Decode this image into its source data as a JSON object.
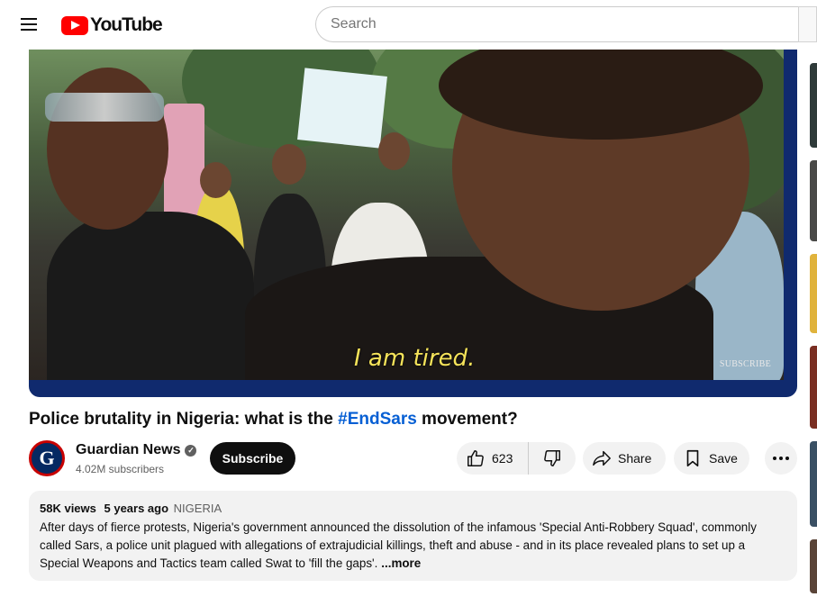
{
  "header": {
    "logo_text": "YouTube",
    "search_placeholder": "Search"
  },
  "player": {
    "caption": "I am tired.",
    "watermark": "SUBSCRIBE"
  },
  "video": {
    "title_prefix": "Police brutality in Nigeria: what is the ",
    "title_hashtag": "#EndSars",
    "title_suffix": " movement?"
  },
  "channel": {
    "avatar_letter": "G",
    "name": "Guardian News",
    "verified_mark": "✓",
    "subscribers": "4.02M subscribers",
    "subscribe_label": "Subscribe"
  },
  "actions": {
    "likes": "623",
    "share_label": "Share",
    "save_label": "Save"
  },
  "description": {
    "views": "58K views",
    "age": "5 years ago",
    "tag": "NIGERIA",
    "text": "After days of fierce protests, Nigeria's government announced the dissolution of the infamous 'Special Anti-Robbery Squad', commonly called Sars, a police unit plagued with allegations of extrajudicial killings, theft and abuse - and in its place revealed plans to set up a Special Weapons and Tactics team called Swat to 'fill the gaps'.",
    "more_label": "...more"
  },
  "colors": {
    "brand_red": "#ff0000",
    "link_blue": "#065fd4",
    "caption_yellow": "#f5e35a",
    "player_border": "#102a6e"
  }
}
